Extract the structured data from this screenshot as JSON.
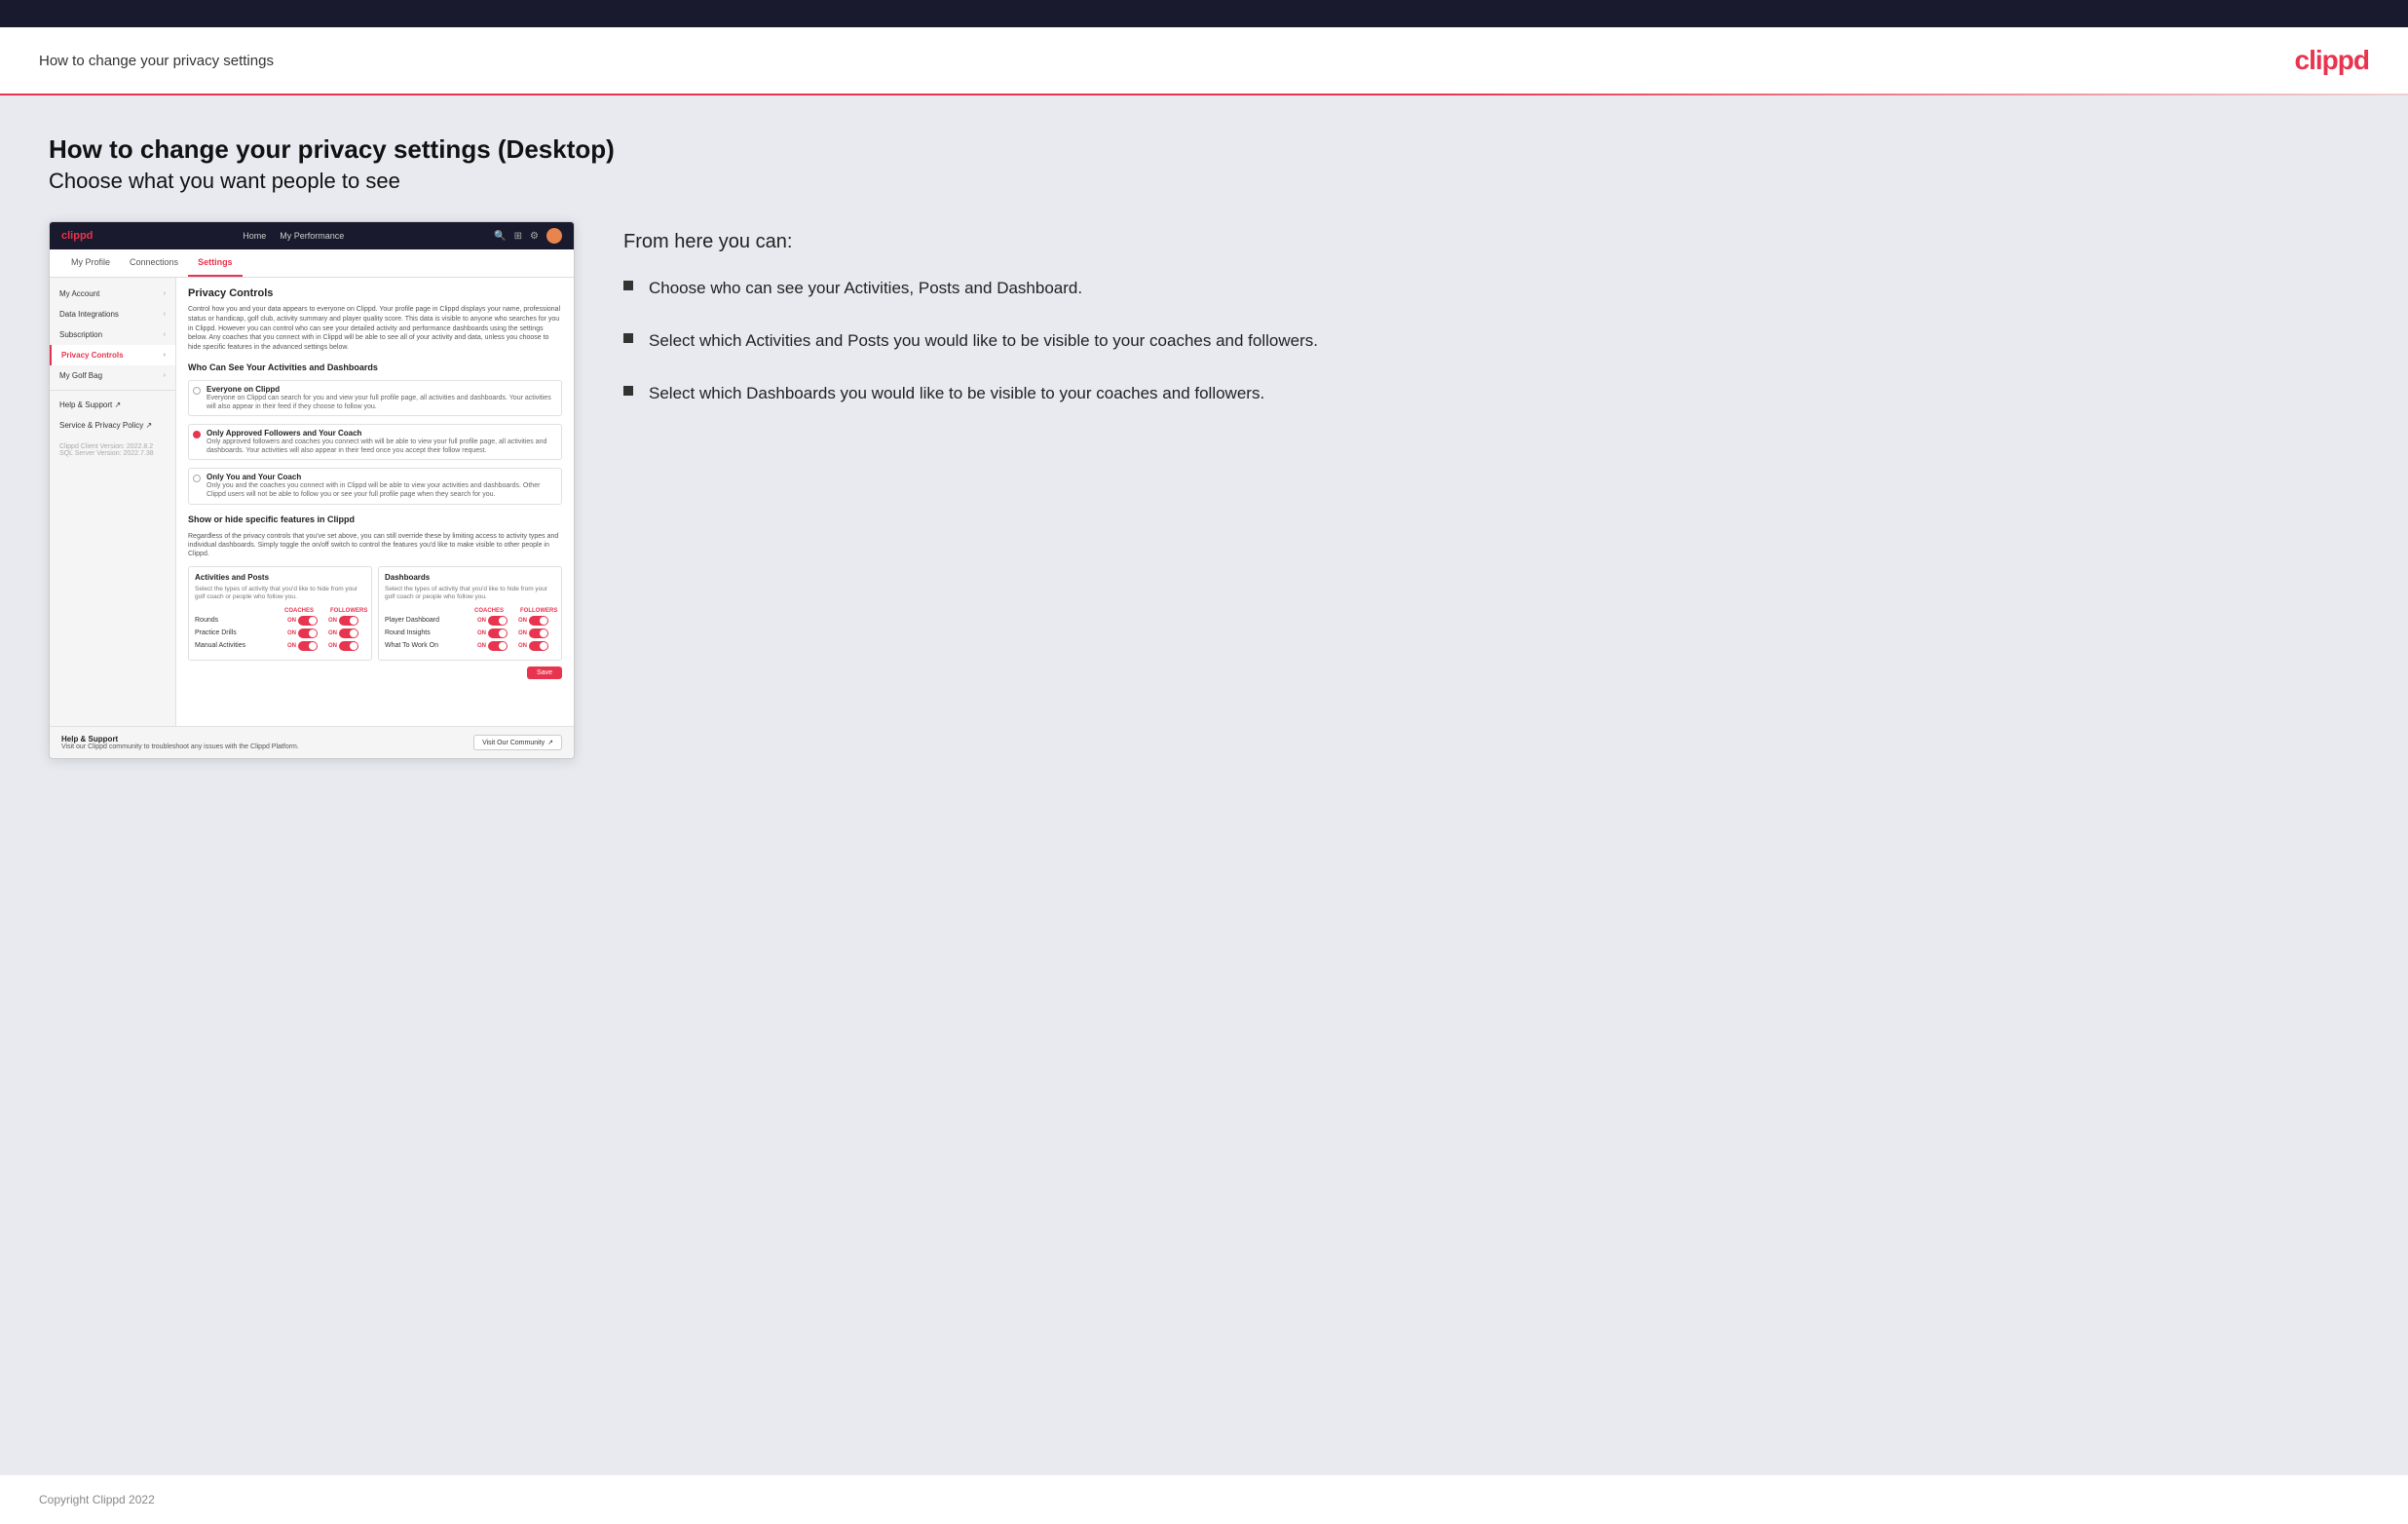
{
  "header": {
    "title": "How to change your privacy settings",
    "logo": "clippd"
  },
  "page": {
    "heading": "How to change your privacy settings (Desktop)",
    "subheading": "Choose what you want people to see"
  },
  "app_mockup": {
    "navbar": {
      "logo": "clippd",
      "links": [
        "Home",
        "My Performance"
      ],
      "icons": [
        "search",
        "grid",
        "settings",
        "avatar"
      ]
    },
    "tabs": [
      "My Profile",
      "Connections",
      "Settings"
    ],
    "active_tab": "Settings",
    "sidebar": {
      "items": [
        {
          "label": "My Account",
          "active": false
        },
        {
          "label": "Data Integrations",
          "active": false
        },
        {
          "label": "Subscription",
          "active": false
        },
        {
          "label": "Privacy Controls",
          "active": true
        },
        {
          "label": "My Golf Bag",
          "active": false
        },
        {
          "label": "Help & Support",
          "active": false
        },
        {
          "label": "Service & Privacy Policy",
          "active": false
        }
      ],
      "footer": {
        "line1": "Clippd Client Version: 2022.8.2",
        "line2": "SQL Server Version: 2022.7.38"
      }
    },
    "panel": {
      "title": "Privacy Controls",
      "description": "Control how you and your data appears to everyone on Clippd. Your profile page in Clippd displays your name, professional status or handicap, golf club, activity summary and player quality score. This data is visible to anyone who searches for you in Clippd. However you can control who can see your detailed activity and performance dashboards using the settings below. Any coaches that you connect with in Clippd will be able to see all of your activity and data, unless you choose to hide specific features in the advanced settings below.",
      "section_title": "Who Can See Your Activities and Dashboards",
      "radio_options": [
        {
          "label": "Everyone on Clippd",
          "description": "Everyone on Clippd can search for you and view your full profile page, all activities and dashboards. Your activities will also appear in their feed if they choose to follow you.",
          "selected": false
        },
        {
          "label": "Only Approved Followers and Your Coach",
          "description": "Only approved followers and coaches you connect with will be able to view your full profile page, all activities and dashboards. Your activities will also appear in their feed once you accept their follow request.",
          "selected": true
        },
        {
          "label": "Only You and Your Coach",
          "description": "Only you and the coaches you connect with in Clippd will be able to view your activities and dashboards. Other Clippd users will not be able to follow you or see your full profile page when they search for you.",
          "selected": false
        }
      ],
      "show_hide": {
        "title": "Show or hide specific features in Clippd",
        "description": "Regardless of the privacy controls that you've set above, you can still override these by limiting access to activity types and individual dashboards. Simply toggle the on/off switch to control the features you'd like to make visible to other people in Clippd.",
        "activities_panel": {
          "title": "Activities and Posts",
          "description": "Select the types of activity that you'd like to hide from your golf coach or people who follow you.",
          "col_labels": [
            "COACHES",
            "FOLLOWERS"
          ],
          "rows": [
            {
              "label": "Rounds",
              "coaches_on": true,
              "followers_on": true
            },
            {
              "label": "Practice Drills",
              "coaches_on": true,
              "followers_on": true
            },
            {
              "label": "Manual Activities",
              "coaches_on": true,
              "followers_on": true
            }
          ]
        },
        "dashboards_panel": {
          "title": "Dashboards",
          "description": "Select the types of activity that you'd like to hide from your golf coach or people who follow you.",
          "col_labels": [
            "COACHES",
            "FOLLOWERS"
          ],
          "rows": [
            {
              "label": "Player Dashboard",
              "coaches_on": true,
              "followers_on": true
            },
            {
              "label": "Round Insights",
              "coaches_on": true,
              "followers_on": true
            },
            {
              "label": "What To Work On",
              "coaches_on": true,
              "followers_on": true
            }
          ]
        }
      },
      "save_label": "Save"
    },
    "help_section": {
      "title": "Help & Support",
      "description": "Visit our Clippd community to troubleshoot any issues with the Clippd Platform.",
      "button_label": "Visit Our Community"
    }
  },
  "right_column": {
    "from_here_title": "From here you can:",
    "bullets": [
      "Choose who can see your Activities, Posts and Dashboard.",
      "Select which Activities and Posts you would like to be visible to your coaches and followers.",
      "Select which Dashboards you would like to be visible to your coaches and followers."
    ]
  },
  "footer": {
    "text": "Copyright Clippd 2022"
  }
}
